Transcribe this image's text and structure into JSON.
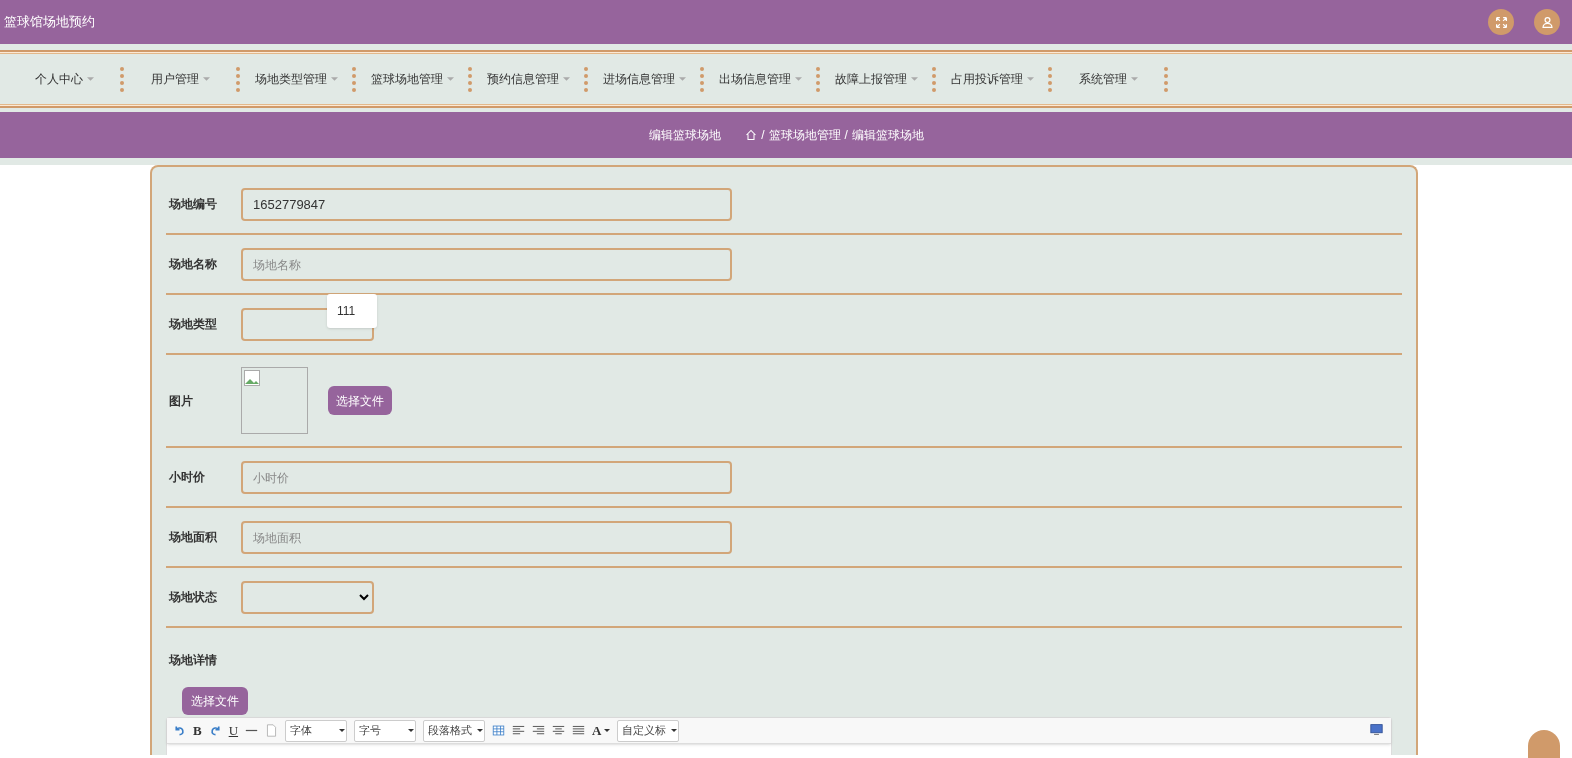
{
  "header": {
    "title": "篮球馆场地预约"
  },
  "nav": [
    {
      "label": "个人中心"
    },
    {
      "label": "用户管理"
    },
    {
      "label": "场地类型管理"
    },
    {
      "label": "篮球场地管理"
    },
    {
      "label": "预约信息管理"
    },
    {
      "label": "进场信息管理"
    },
    {
      "label": "出场信息管理"
    },
    {
      "label": "故障上报管理"
    },
    {
      "label": "占用投诉管理"
    },
    {
      "label": "系统管理"
    }
  ],
  "breadcrumb": {
    "page_title": "编辑篮球场地",
    "separator": "/",
    "trail": [
      "篮球场地管理",
      "编辑篮球场地"
    ]
  },
  "form": {
    "fields": [
      {
        "kind": "text",
        "label": "场地编号",
        "value": "1652779847"
      },
      {
        "kind": "text",
        "label": "场地名称",
        "placeholder": "场地名称",
        "tooltip": "111"
      },
      {
        "kind": "select",
        "label": "场地类型"
      },
      {
        "kind": "image",
        "label": "图片",
        "button": "选择文件"
      },
      {
        "kind": "text",
        "label": "小时价",
        "placeholder": "小时价"
      },
      {
        "kind": "text",
        "label": "场地面积",
        "placeholder": "场地面积"
      },
      {
        "kind": "select",
        "label": "场地状态"
      },
      {
        "kind": "editor",
        "label": "场地详情",
        "button": "选择文件"
      }
    ]
  },
  "editor_toolbar": {
    "bold": "B",
    "underline": "U",
    "font_color": "A",
    "selects": [
      "字体",
      "字号",
      "段落格式"
    ],
    "custom_title": "自定义标"
  }
}
